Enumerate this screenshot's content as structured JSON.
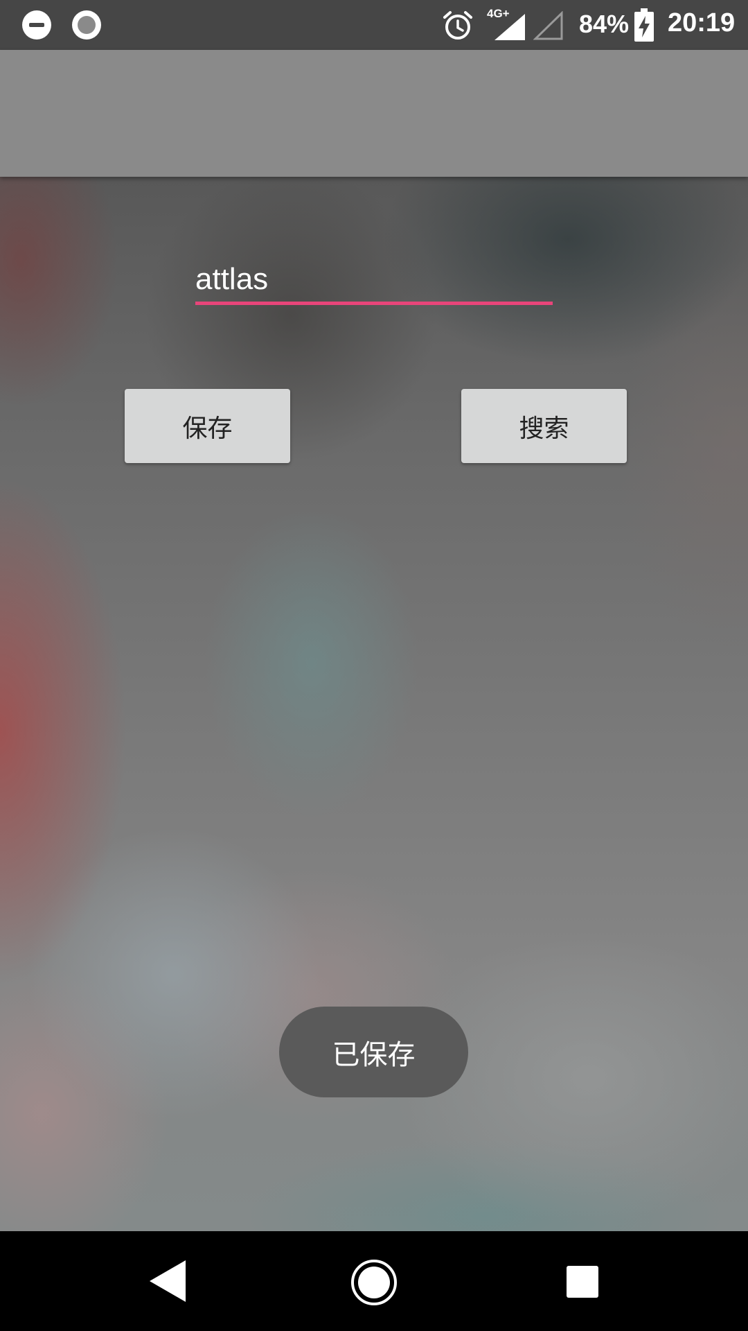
{
  "status_bar": {
    "network_type": "4G+",
    "battery_percent": "84%",
    "time": "20:19",
    "icons": [
      "do-not-disturb-icon",
      "screen-record-icon",
      "alarm-icon",
      "signal-icon",
      "signal-empty-icon",
      "battery-charging-icon"
    ]
  },
  "main": {
    "input_value": "attlas",
    "save_label": "保存",
    "search_label": "搜索"
  },
  "toast": {
    "message": "已保存"
  },
  "navigation": {
    "icons": [
      "back-icon",
      "home-icon",
      "recents-icon"
    ]
  },
  "colors": {
    "accent": "#e8457a",
    "toolbar": "#8a8a8a",
    "status_bar": "#464646",
    "button": "#d6d7d7",
    "toast": "#5a5a5a"
  }
}
